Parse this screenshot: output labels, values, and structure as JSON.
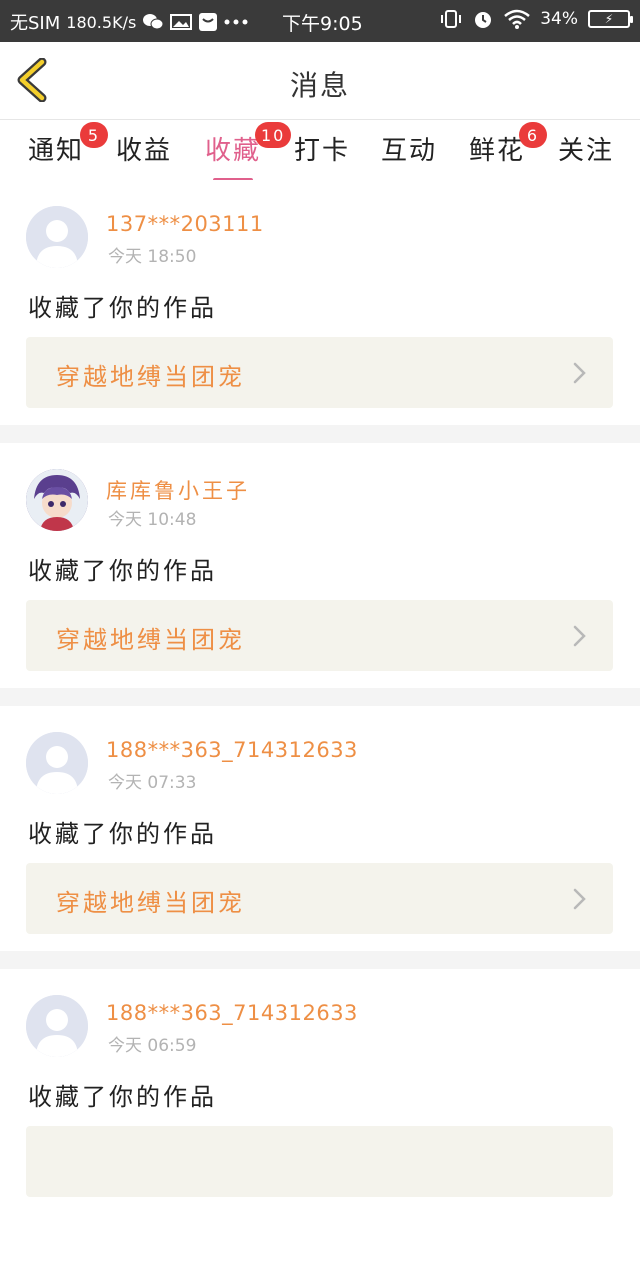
{
  "status_bar": {
    "carrier": "无SIM",
    "speed": "180.5K/s",
    "time": "下午9:05",
    "battery": "34%"
  },
  "header": {
    "title": "消息"
  },
  "tabs": [
    {
      "label": "通知",
      "badge": "5"
    },
    {
      "label": "收益",
      "badge": ""
    },
    {
      "label": "收藏",
      "badge": "10"
    },
    {
      "label": "打卡",
      "badge": ""
    },
    {
      "label": "互动",
      "badge": ""
    },
    {
      "label": "鲜花",
      "badge": "6"
    },
    {
      "label": "关注",
      "badge": ""
    }
  ],
  "active_tab": "收藏",
  "accent_color": "#e0608c",
  "name_color": "#ee8f45",
  "messages": [
    {
      "user": "137***203111",
      "time": "今天 18:50",
      "action": "收藏了你的作品",
      "work": "穿越地缚当团宠",
      "avatar": "default-avatar"
    },
    {
      "user": "库库鲁小王子",
      "time": "今天 10:48",
      "action": "收藏了你的作品",
      "work": "穿越地缚当团宠",
      "avatar": "anime-avatar"
    },
    {
      "user": "188***363_714312633",
      "time": "今天 07:33",
      "action": "收藏了你的作品",
      "work": "穿越地缚当团宠",
      "avatar": "default-avatar"
    },
    {
      "user": "188***363_714312633",
      "time": "今天 06:59",
      "action": "收藏了你的作品",
      "work": "",
      "avatar": "default-avatar"
    }
  ]
}
